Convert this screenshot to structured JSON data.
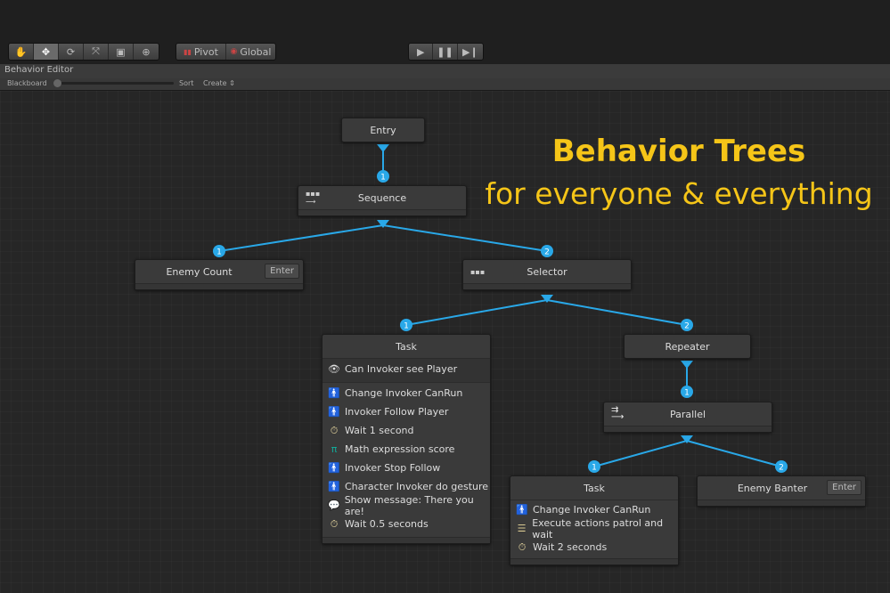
{
  "toolbar": {
    "tools": [
      "hand-icon",
      "move-icon",
      "rotate-icon",
      "scale-icon",
      "rect-icon",
      "transform-icon"
    ],
    "pivot": "Pivot",
    "global": "Global",
    "play": [
      "play-icon",
      "pause-icon",
      "step-icon"
    ]
  },
  "editor": {
    "title": "Behavior Editor",
    "blackboard": "Blackboard",
    "sort": "Sort",
    "create": "Create ⇕"
  },
  "headline": {
    "line1": "Behavior Trees",
    "line2": "for everyone & everything",
    "color": "#f5c518"
  },
  "accent": "#29a8e8",
  "nodes": {
    "entry": "Entry",
    "sequence": "Sequence",
    "enemy_count": "Enemy Count",
    "enter": "Enter",
    "selector": "Selector",
    "task1": {
      "title": "Task",
      "condition": "Can Invoker see Player",
      "actions": [
        "Change Invoker CanRun",
        "Invoker Follow Player",
        "Wait 1 second",
        "Math expression score",
        "Invoker Stop Follow",
        "Character Invoker do gesture",
        "Show message: There you are!",
        "Wait 0.5 seconds"
      ]
    },
    "repeater": "Repeater",
    "parallel": "Parallel",
    "task2": {
      "title": "Task",
      "actions": [
        "Change Invoker CanRun",
        "Execute actions patrol and wait",
        "Wait 2 seconds"
      ]
    },
    "enemy_banter": "Enemy Banter"
  },
  "badges": {
    "one": "1",
    "two": "2"
  }
}
